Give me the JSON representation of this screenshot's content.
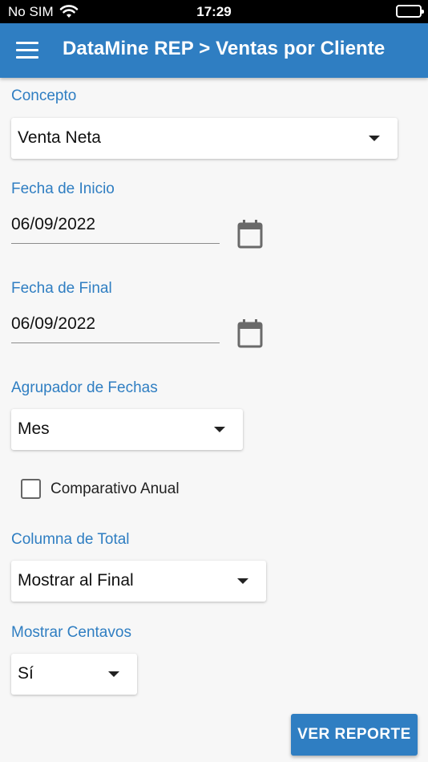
{
  "status_bar": {
    "carrier": "No SIM",
    "time": "17:29"
  },
  "app_bar": {
    "title": "DataMine REP > Ventas por Cliente"
  },
  "form": {
    "concepto": {
      "label": "Concepto",
      "value": "Venta Neta"
    },
    "fecha_inicio": {
      "label": "Fecha de Inicio",
      "value": "06/09/2022"
    },
    "fecha_final": {
      "label": "Fecha de Final",
      "value": "06/09/2022"
    },
    "agrupador": {
      "label": "Agrupador de Fechas",
      "value": "Mes"
    },
    "comparativo": {
      "label": "Comparativo Anual",
      "checked": false
    },
    "columna_total": {
      "label": "Columna de Total",
      "value": "Mostrar al Final"
    },
    "centavos": {
      "label": "Mostrar Centavos",
      "value": "Sí"
    }
  },
  "actions": {
    "ver_reporte": "VER REPORTE"
  },
  "colors": {
    "primary": "#2f7ec2",
    "background": "#f7f7f7"
  },
  "icons": [
    "wifi-icon",
    "battery-icon",
    "menu-icon",
    "calendar-icon",
    "dropdown-arrow-icon",
    "checkbox-icon"
  ]
}
